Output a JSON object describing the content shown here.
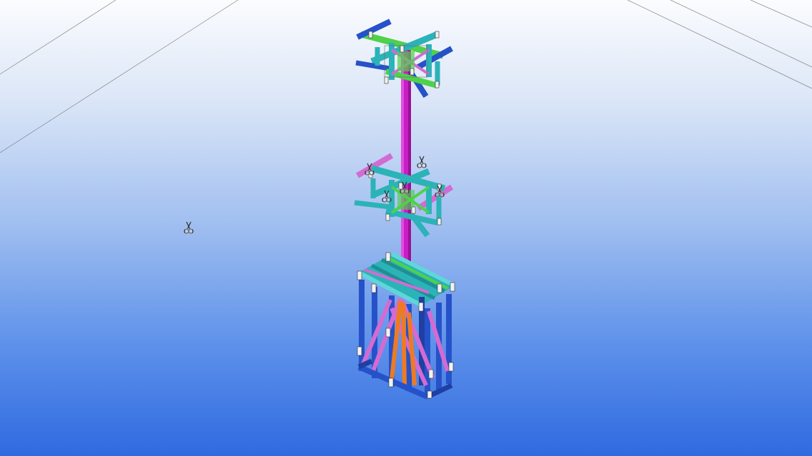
{
  "viewport": {
    "view_type": "3D model view",
    "background_top": "#fbfcfe",
    "background_bottom": "#2f6ae0"
  },
  "model": {
    "colors": {
      "column": "#c81fc4",
      "beam_green": "#4fd14a",
      "beam_teal": "#2bb3b8",
      "beam_blue": "#2652c9",
      "brace_pink": "#d36bd2",
      "brace_orange": "#f07a1f",
      "plate_white": "#f2f2f2"
    },
    "cut_markers": [
      {
        "name": "scissors-icon"
      },
      {
        "name": "scissors-icon"
      },
      {
        "name": "scissors-icon"
      },
      {
        "name": "scissors-icon"
      },
      {
        "name": "scissors-icon"
      },
      {
        "name": "scissors-icon"
      }
    ]
  }
}
